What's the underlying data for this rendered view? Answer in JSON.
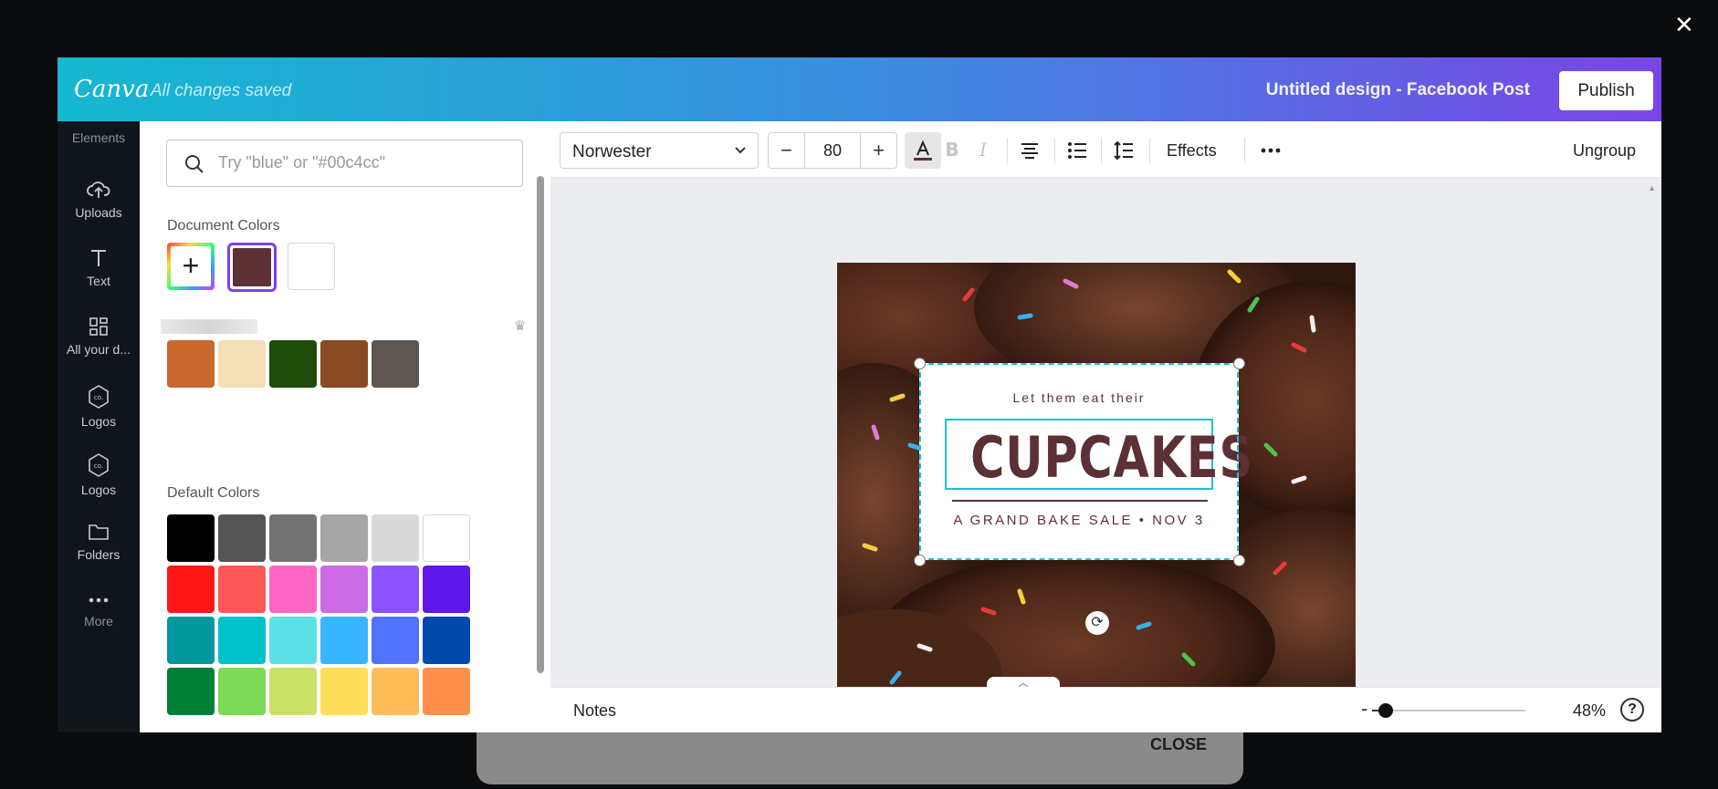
{
  "background": {
    "close_glyph": "✕",
    "close_label": "CLOSE"
  },
  "header": {
    "logo": "Canva",
    "save_status": "All changes saved",
    "design_title": "Untitled design - Facebook Post",
    "publish_label": "Publish"
  },
  "sidebar": {
    "items": [
      {
        "label": "Elements",
        "icon": "elements-icon"
      },
      {
        "label": "Uploads",
        "icon": "upload-cloud-icon"
      },
      {
        "label": "Text",
        "icon": "text-icon"
      },
      {
        "label": "All your d...",
        "icon": "grid-icon"
      },
      {
        "label": "Logos",
        "icon": "logo-hexagon-icon"
      },
      {
        "label": "Logos",
        "icon": "logo-hexagon-icon"
      },
      {
        "label": "Folders",
        "icon": "folder-icon"
      },
      {
        "label": "More",
        "icon": "more-dots-icon"
      }
    ]
  },
  "color_panel": {
    "search_placeholder": "Try \"blue\" or \"#00c4cc\"",
    "document_colors_label": "Document Colors",
    "document_colors": [
      "#5c3035",
      "#ffffff"
    ],
    "brand_colors": [
      "#c8672e",
      "#f4dfb6",
      "#1e4d0b",
      "#8a4a22",
      "#5e5650"
    ],
    "default_colors_label": "Default Colors",
    "default_colors": [
      [
        "#000000",
        "#545454",
        "#737373",
        "#a6a6a6",
        "#d9d9d9",
        "#ffffff"
      ],
      [
        "#ff1616",
        "#ff5757",
        "#ff66c4",
        "#cb6ce6",
        "#8c52ff",
        "#5e17eb"
      ],
      [
        "#03989e",
        "#00c2cb",
        "#5ce1e6",
        "#38b6ff",
        "#5271ff",
        "#004aad"
      ],
      [
        "#008037",
        "#7ed957",
        "#c9e265",
        "#ffde59",
        "#ffbd59",
        "#ff914d"
      ]
    ]
  },
  "toolbar": {
    "font_name": "Norwester",
    "font_size": "80",
    "size_minus": "−",
    "size_plus": "+",
    "text_color": "#5c3035",
    "effects_label": "Effects",
    "ungroup_label": "Ungroup"
  },
  "design": {
    "tagline": "Let them eat their",
    "headline": "CUPCAKES",
    "subline": "A GRAND BAKE SALE • NOV 3",
    "text_color": "#5c3035",
    "selection_color": "#1ec0d8"
  },
  "footer": {
    "notes_label": "Notes",
    "zoom_minus": "-",
    "zoom_value": "48%",
    "zoom_fraction": 0.09,
    "help_label": "?"
  }
}
